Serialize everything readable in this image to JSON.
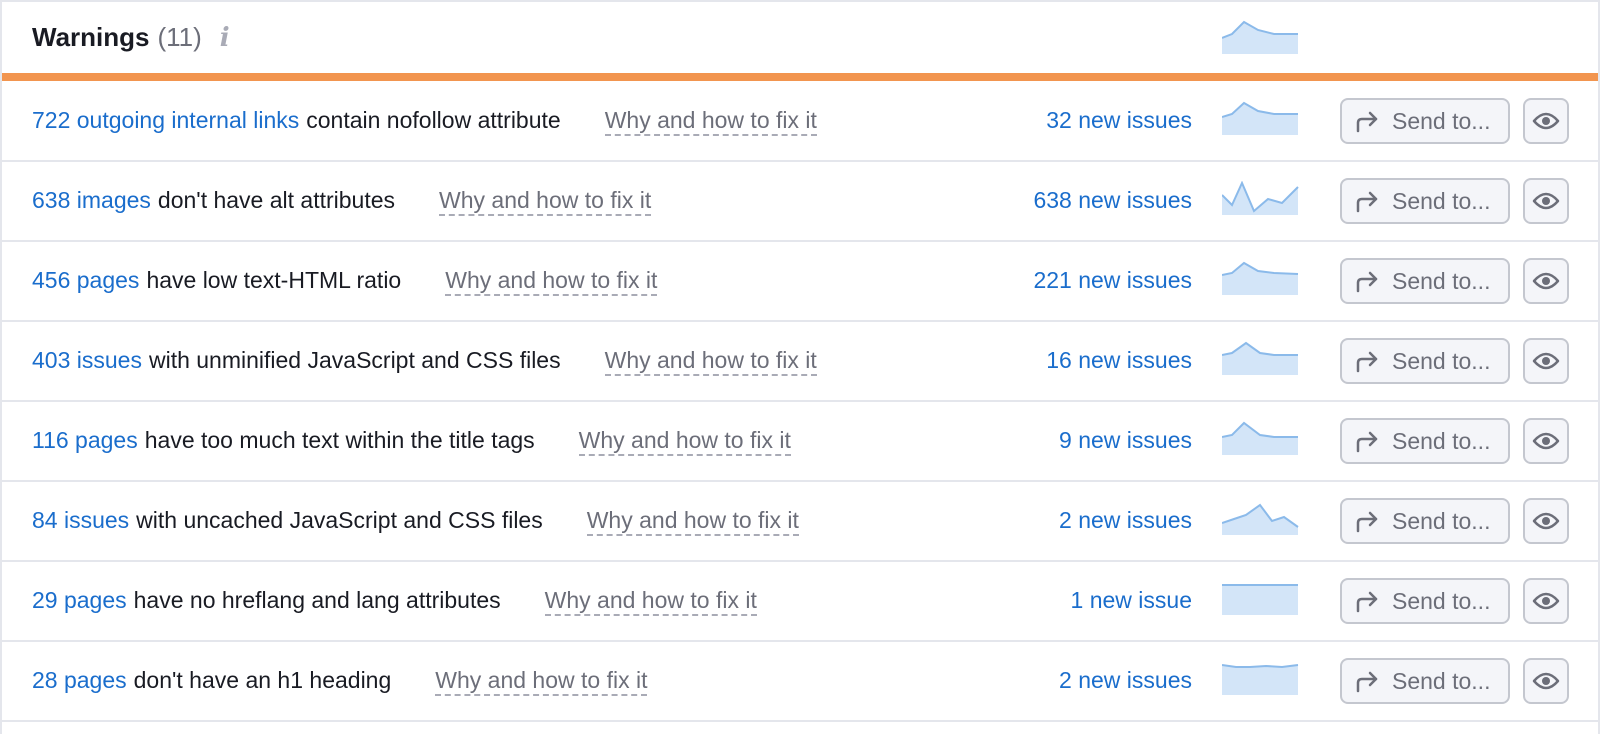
{
  "header": {
    "title": "Warnings",
    "count": "(11)",
    "info_icon": "info-icon"
  },
  "colors": {
    "accent": "#f2954f",
    "link": "#1a6dcc",
    "sparkline_fill": "#d3e5f8",
    "sparkline_line": "#8bbaea"
  },
  "row_common": {
    "why_label": "Why and how to fix it",
    "send_label": "Send to...",
    "send_icon": "share-arrow-icon",
    "eye_icon": "eye-icon"
  },
  "rows": [
    {
      "count_link": "722 outgoing internal links",
      "text": "contain nofollow attribute",
      "new_issues": "32 new issues"
    },
    {
      "count_link": "638 images",
      "text": "don't have alt attributes",
      "new_issues": "638 new issues"
    },
    {
      "count_link": "456 pages",
      "text": "have low text-HTML ratio",
      "new_issues": "221 new issues"
    },
    {
      "count_link": "403 issues",
      "text": "with unminified JavaScript and CSS files",
      "new_issues": "16 new issues"
    },
    {
      "count_link": "116 pages",
      "text": "have too much text within the title tags",
      "new_issues": "9 new issues"
    },
    {
      "count_link": "84 issues",
      "text": "with uncached JavaScript and CSS files",
      "new_issues": "2 new issues"
    },
    {
      "count_link": "29 pages",
      "text": "have no hreflang and lang attributes",
      "new_issues": "1 new issue"
    },
    {
      "count_link": "28 pages",
      "text": "don't have an h1 heading",
      "new_issues": "2 new issues"
    }
  ]
}
